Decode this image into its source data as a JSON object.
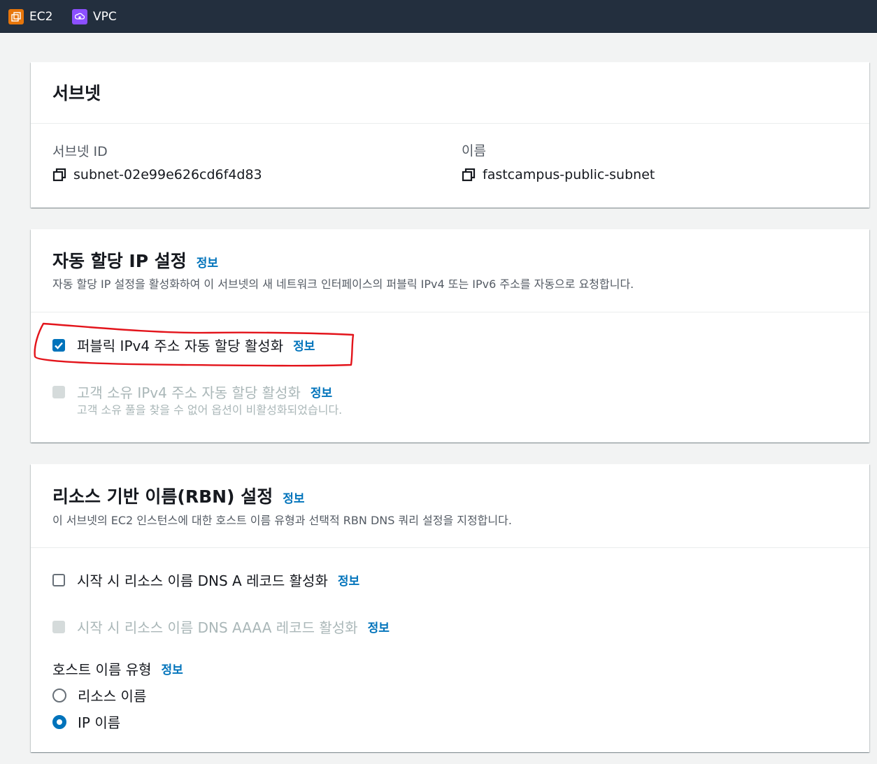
{
  "topbar": {
    "services": [
      {
        "label": "EC2",
        "icon": "ec2-icon"
      },
      {
        "label": "VPC",
        "icon": "vpc-icon"
      }
    ]
  },
  "subnet_card": {
    "title": "서브넷",
    "subnet_id_label": "서브넷 ID",
    "subnet_id_value": "subnet-02e99e626cd6f4d83",
    "name_label": "이름",
    "name_value": "fastcampus-public-subnet"
  },
  "auto_ip_card": {
    "title": "자동 할당 IP 설정",
    "info": "정보",
    "description": "자동 할당 IP 설정을 활성화하여 이 서브넷의 새 네트워크 인터페이스의 퍼블릭 IPv4 또는 IPv6 주소를 자동으로 요청합니다.",
    "public_ipv4_label": "퍼블릭 IPv4 주소 자동 할당 활성화",
    "public_ipv4_checked": true,
    "public_ipv4_info": "정보",
    "customer_ipv4_label": "고객 소유 IPv4 주소 자동 할당 활성화",
    "customer_ipv4_info": "정보",
    "customer_ipv4_disabled_note": "고객 소유 풀을 찾을 수 없어 옵션이 비활성화되었습니다.",
    "annotation_color": "#e3141b"
  },
  "rbn_card": {
    "title": "리소스 기반 이름(RBN) 설정",
    "info": "정보",
    "description": "이 서브넷의 EC2 인스턴스에 대한 호스트 이름 유형과 선택적 RBN DNS 쿼리 설정을 지정합니다.",
    "dns_a_label": "시작 시 리소스 이름 DNS A 레코드 활성화",
    "dns_a_info": "정보",
    "dns_aaaa_label": "시작 시 리소스 이름 DNS AAAA 레코드 활성화",
    "dns_aaaa_info": "정보",
    "hostname_type_label": "호스트 이름 유형",
    "hostname_type_info": "정보",
    "hostname_options": [
      {
        "label": "리소스 이름",
        "selected": false
      },
      {
        "label": "IP 이름",
        "selected": true
      }
    ]
  },
  "colors": {
    "accent": "#0073bb",
    "topbar": "#232f3e",
    "background": "#f2f3f3"
  }
}
